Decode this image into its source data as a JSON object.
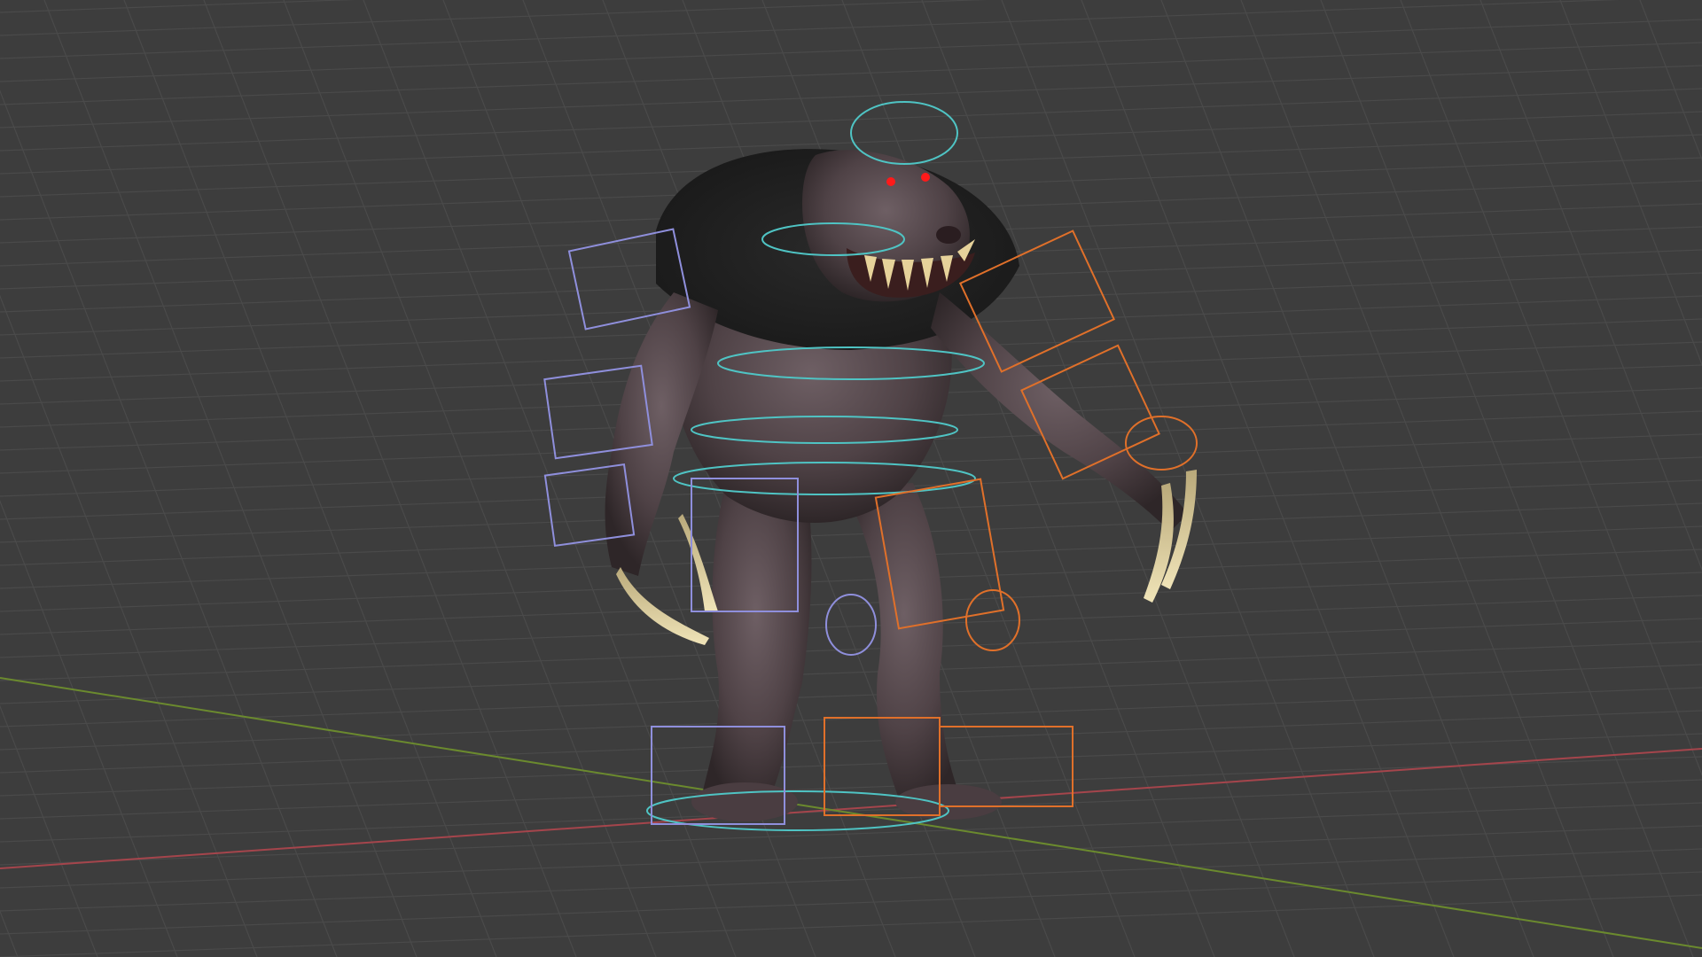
{
  "app": "3D viewport",
  "viewport": {
    "background": "#3d3d3d",
    "grid_color": "#4a4a4a",
    "x_axis_color": "#a5454c",
    "y_axis_color": "#6b8a2e"
  },
  "rig_colors": {
    "center_controls": "#4fc4c4",
    "left_controls": "#8f8fdc",
    "right_controls": "#e0702a"
  },
  "model": {
    "icon": "creature-model",
    "eye_color": "#ff1a1a",
    "claw_color": "#e6d29a"
  }
}
